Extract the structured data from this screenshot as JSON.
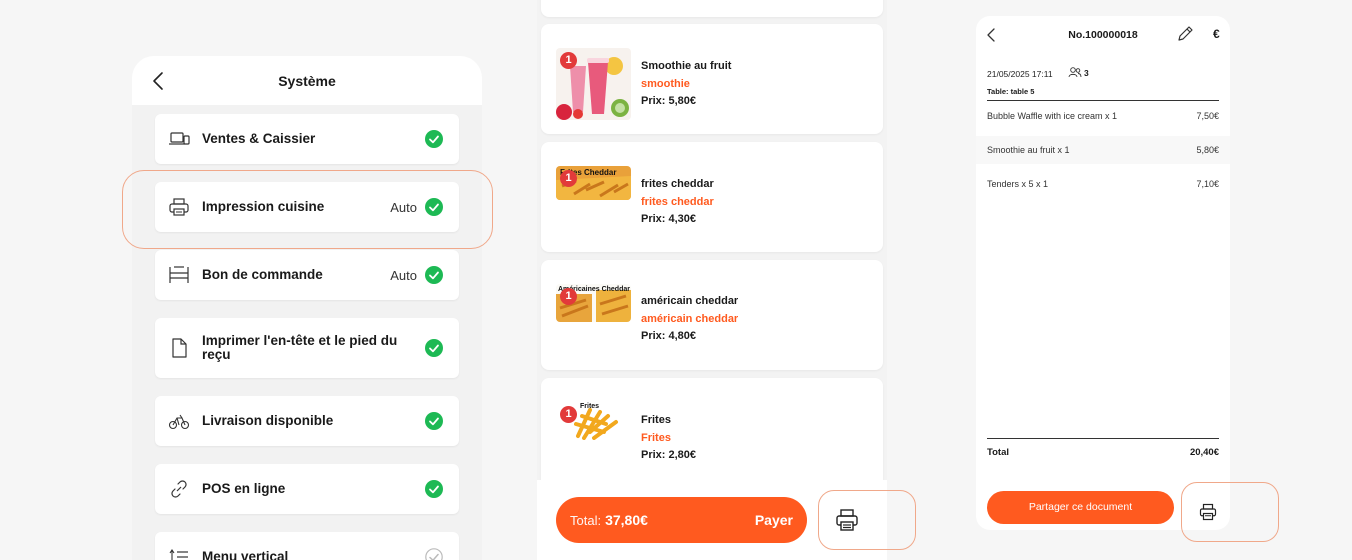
{
  "system": {
    "title": "Système",
    "rows": [
      {
        "label": "Ventes & Caissier",
        "status": "",
        "enabled": true
      },
      {
        "label": "Impression cuisine",
        "status": "Auto",
        "enabled": true
      },
      {
        "label": "Bon de commande",
        "status": "Auto",
        "enabled": true
      },
      {
        "label": "Imprimer l'en-tête et le pied du reçu",
        "status": "",
        "enabled": true
      },
      {
        "label": "Livraison disponible",
        "status": "",
        "enabled": true
      },
      {
        "label": "POS en ligne",
        "status": "",
        "enabled": true
      },
      {
        "label": "Menu vertical",
        "status": "",
        "enabled": false
      }
    ]
  },
  "products": {
    "items": [
      {
        "qty": "1",
        "name": "Smoothie au fruit",
        "sub": "smoothie",
        "price": "Prix: 5,80€",
        "image_text": ""
      },
      {
        "qty": "1",
        "name": "frites cheddar",
        "sub": "frites cheddar",
        "price": "Prix: 4,30€",
        "image_text": "Frites Cheddar"
      },
      {
        "qty": "1",
        "name": "américain cheddar",
        "sub": "américain cheddar",
        "price": "Prix: 4,80€",
        "image_text": "Américaines Cheddar"
      },
      {
        "qty": "1",
        "name": "Frites",
        "sub": "Frites",
        "price": "Prix: 2,80€",
        "image_text": "Frites"
      }
    ],
    "total_label": "Total:",
    "total_value": "37,80€",
    "pay_label": "Payer"
  },
  "receipt": {
    "number": "No.100000018",
    "currency": "€",
    "date": "21/05/2025 17:11",
    "guests": "3",
    "table": "Table: table 5",
    "items": [
      {
        "name": "Bubble Waffle with ice cream x 1",
        "price": "7,50€"
      },
      {
        "name": "Smoothie au fruit x 1",
        "price": "5,80€"
      },
      {
        "name": "Tenders x 5 x 1",
        "price": "7,10€"
      }
    ],
    "total_label": "Total",
    "total_value": "20,40€",
    "share_label": "Partager ce document"
  },
  "colors": {
    "accent": "#ff5a1f",
    "check": "#1db954",
    "badge": "#e23a3a"
  }
}
